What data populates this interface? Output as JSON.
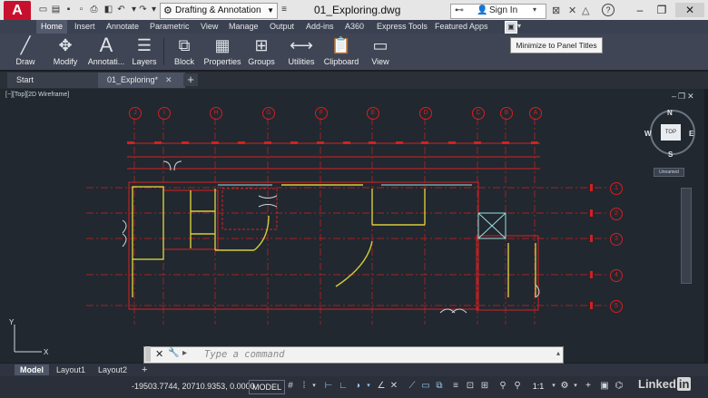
{
  "app": {
    "logo_letter": "A",
    "document_title": "01_Exploring.dwg"
  },
  "quick_access": {
    "workspace": "Drafting & Annotation",
    "icons": [
      "new-icon",
      "open-icon",
      "save-icon",
      "save-as-icon",
      "print-icon",
      "undo-icon",
      "redo-icon"
    ]
  },
  "search": {
    "sign_in": "Sign In",
    "icons": [
      "binoculars-icon",
      "user-icon",
      "cart-icon",
      "exchange-icon",
      "help-icon"
    ]
  },
  "ribbon": {
    "tabs": [
      "Home",
      "Insert",
      "Annotate",
      "Parametric",
      "View",
      "Manage",
      "Output",
      "Add-ins",
      "A360",
      "Express Tools",
      "Featured Apps"
    ],
    "active_tab": "Home",
    "panels": [
      {
        "label": "Draw",
        "icon": "line-icon"
      },
      {
        "label": "Modify",
        "icon": "move-icon"
      },
      {
        "label": "Annotati...",
        "icon": "text-icon"
      },
      {
        "label": "Layers",
        "icon": "layers-icon"
      },
      {
        "label": "Block",
        "icon": "block-icon"
      },
      {
        "label": "Properties",
        "icon": "properties-icon"
      },
      {
        "label": "Groups",
        "icon": "groups-icon"
      },
      {
        "label": "Utilities",
        "icon": "measure-icon"
      },
      {
        "label": "Clipboard",
        "icon": "clipboard-icon"
      },
      {
        "label": "View",
        "icon": "view-icon"
      }
    ],
    "tooltip": "Minimize to Panel Titles"
  },
  "doc_tabs": [
    {
      "label": "Start"
    },
    {
      "label": "01_Exploring*"
    }
  ],
  "viewport": {
    "label": "[−][Top][2D Wireframe]",
    "viewcube": {
      "face": "TOP",
      "n": "N",
      "s": "S",
      "e": "E",
      "w": "W",
      "ucs": "Unnamed"
    },
    "grid_top": [
      "J",
      "I",
      "H",
      "G",
      "F",
      "E",
      "D",
      "C",
      "B",
      "A"
    ],
    "grid_right": [
      "1",
      "2",
      "3",
      "4",
      "5"
    ]
  },
  "command": {
    "placeholder": "Type a command"
  },
  "layouts": [
    "Model",
    "Layout1",
    "Layout2"
  ],
  "status": {
    "coords": "-19503.7744, 20710.9353, 0.0000",
    "space": "MODEL",
    "scale": "1:1"
  },
  "watermark": "Linked",
  "watermark_in": "in",
  "colors": {
    "drawing_bg": "#212830",
    "grid_red": "#d61f1f",
    "walls_yellow": "#d8cc3a",
    "accent_cyan": "#5ab8e8"
  }
}
